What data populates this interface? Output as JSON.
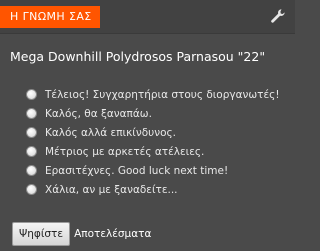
{
  "header": {
    "title": "Η ΓΝΩΜΗ ΣΑΣ",
    "accent_color": "#ff5500",
    "settings_icon": "wrench-icon"
  },
  "poll": {
    "question": "Mega Downhill Polydrosos Parnasou \"22\"",
    "options": [
      {
        "label": "Τέλειος! Συγχαρητήρια στους διοργανωτές!",
        "selected": false
      },
      {
        "label": "Καλός, θα ξαναπάω.",
        "selected": false
      },
      {
        "label": "Καλός αλλά επικίνδυνος.",
        "selected": false
      },
      {
        "label": "Μέτριος με αρκετές ατέλειες.",
        "selected": false
      },
      {
        "label": "Ερασιτέχνες. Good luck next time!",
        "selected": false
      },
      {
        "label": "Χάλια, αν με ξαναδείτε...",
        "selected": false
      }
    ]
  },
  "actions": {
    "vote_label": "Ψηφίστε",
    "results_label": "Αποτελέσματα"
  }
}
